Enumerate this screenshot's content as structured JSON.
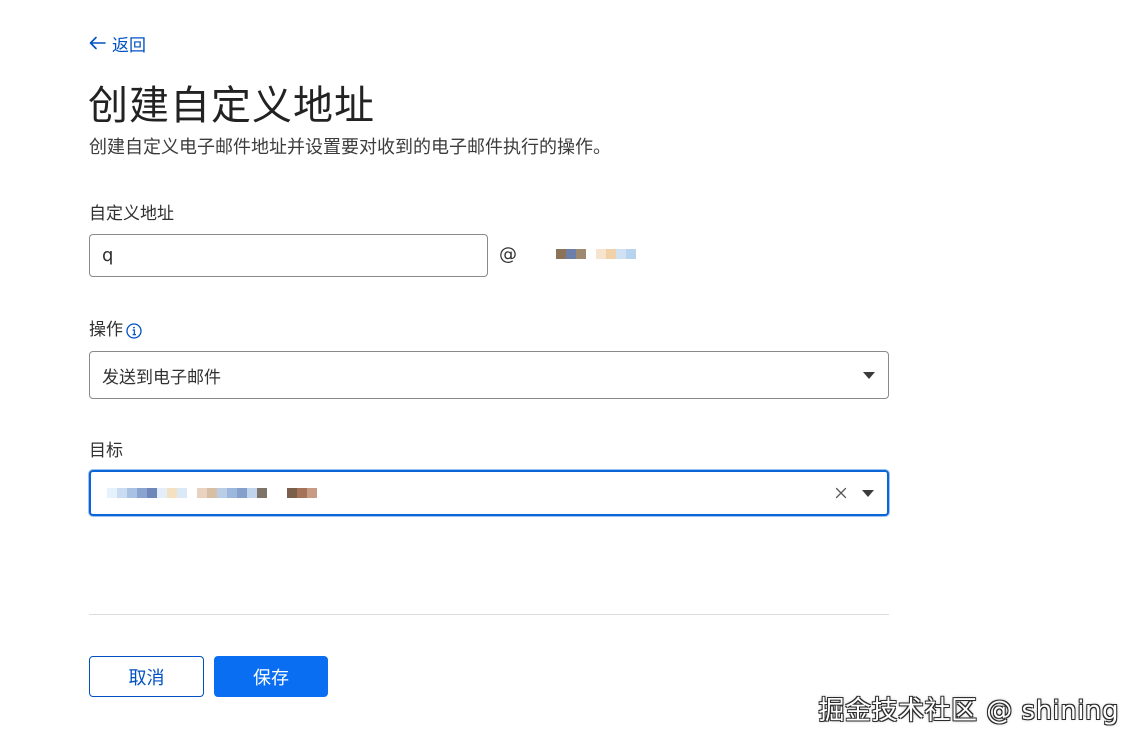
{
  "nav": {
    "back_label": "返回"
  },
  "header": {
    "title": "创建自定义地址",
    "subtitle": "创建自定义电子邮件地址并设置要对收到的电子邮件执行的操作。"
  },
  "form": {
    "address": {
      "label": "自定义地址",
      "value": "q",
      "at_symbol": "@"
    },
    "action": {
      "label": "操作",
      "info_icon": "info-circle-icon",
      "selected": "发送到电子邮件"
    },
    "target": {
      "label": "目标",
      "clear_icon": "close-icon",
      "focused": true
    }
  },
  "buttons": {
    "cancel_label": "取消",
    "save_label": "保存"
  },
  "watermark": {
    "text": "掘金技术社区 @ shining"
  },
  "colors": {
    "link": "#0051c3",
    "primary_button": "#0a6ef2",
    "focus_border": "#0a66d6",
    "input_border": "#8a8a8a",
    "divider": "#dcdcdc"
  },
  "redacted": {
    "domain_pixels": [
      "#8b7358",
      "#6b7fa8",
      "#a08a6f",
      "#ffffff",
      "#f7e4cf",
      "#f1d1a8",
      "#cfe1f3",
      "#b8d3ee"
    ],
    "target_pixels": [
      "#e6f2fb",
      "#c9dcf1",
      "#a9c1e3",
      "#8ba4cf",
      "#6e86b8",
      "#e3eef9",
      "#f4e1c2",
      "#dbe9f7",
      "#ffffff",
      "#e9d2c0",
      "#d7bfa5",
      "#b9cde6",
      "#9cb6dc",
      "#86a0cc",
      "#c0d4ee",
      "#7d7467",
      "#ffffff",
      "#ffffff",
      "#7c5f4b",
      "#a6735a",
      "#c79b84"
    ]
  }
}
